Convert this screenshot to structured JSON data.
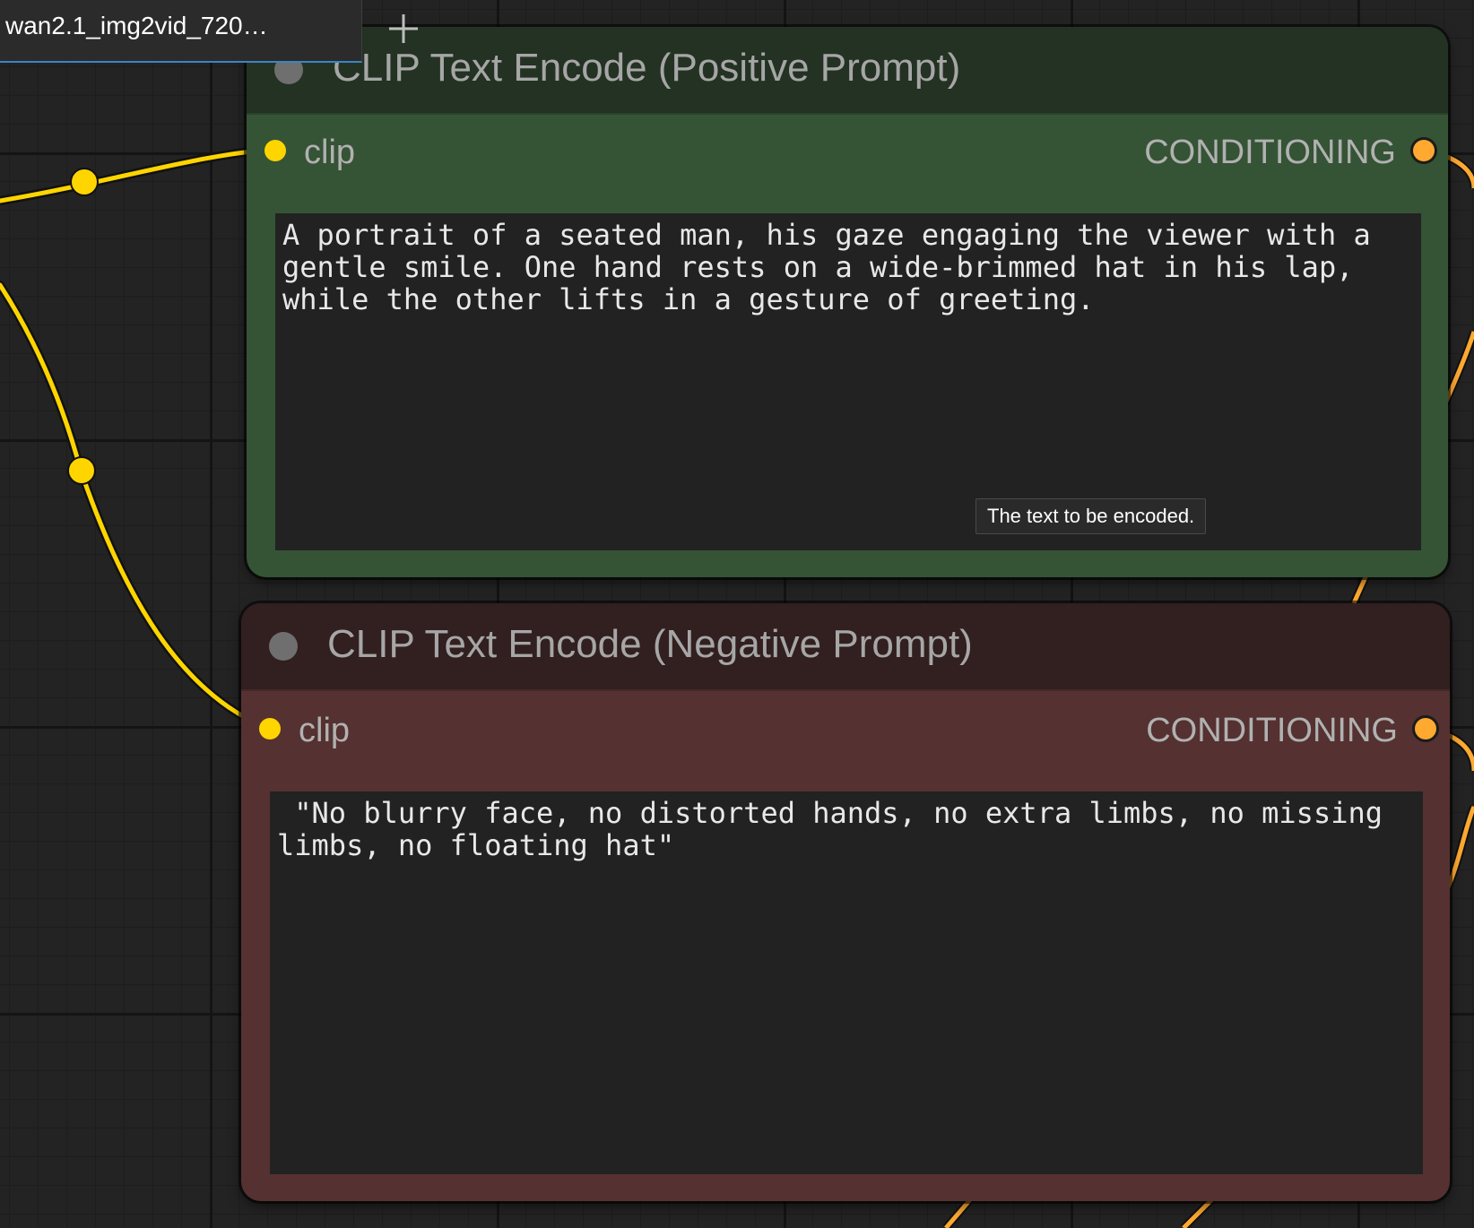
{
  "workflow_tab": {
    "title": "wan2.1_img2vid_720…",
    "new_tab_icon": "plus-icon"
  },
  "colors": {
    "clip_link": "#ffd500",
    "conditioning_link": "#ffa931",
    "positive_node_body": "#355335",
    "positive_node_header": "#233223",
    "negative_node_body": "#553131",
    "negative_node_header": "#321f20"
  },
  "nodes": [
    {
      "title": "CLIP Text Encode (Positive Prompt)",
      "input_label": "clip",
      "output_label": "CONDITIONING",
      "text": "A portrait of a seated man, his gaze engaging the viewer with a\ngentle smile. One hand rests on a wide-brimmed hat in his lap,\nwhile the other lifts in a gesture of greeting.",
      "tooltip": "The text to be encoded."
    },
    {
      "title": "CLIP Text Encode (Negative Prompt)",
      "input_label": "clip",
      "output_label": "CONDITIONING",
      "text": " \"No blurry face, no distorted hands, no extra limbs, no missing\nlimbs, no floating hat\""
    }
  ]
}
